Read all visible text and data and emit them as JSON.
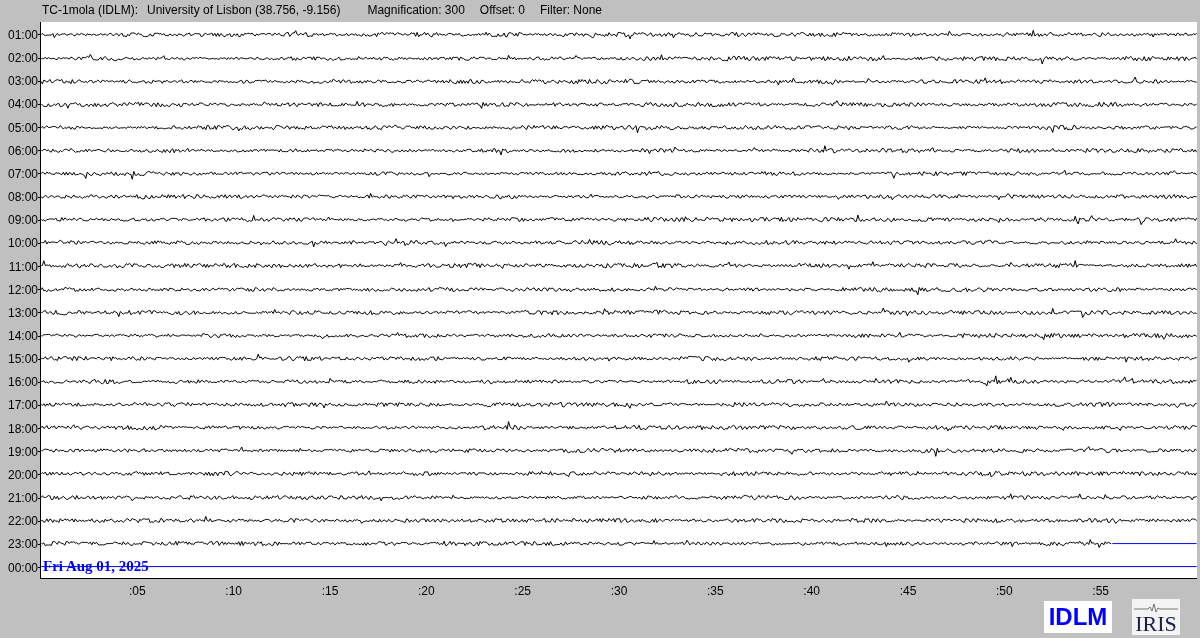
{
  "header": {
    "station": "TC-1mola (IDLM):",
    "location": "University of Lisbon (38.756, -9.156)",
    "magnification": "Magnification: 300",
    "offset": "Offset: 0",
    "filter": "Filter: None"
  },
  "rows": [
    {
      "time": "01:00",
      "kind": "trace"
    },
    {
      "time": "02:00",
      "kind": "trace"
    },
    {
      "time": "03:00",
      "kind": "trace"
    },
    {
      "time": "04:00",
      "kind": "trace"
    },
    {
      "time": "05:00",
      "kind": "trace"
    },
    {
      "time": "06:00",
      "kind": "trace"
    },
    {
      "time": "07:00",
      "kind": "trace"
    },
    {
      "time": "08:00",
      "kind": "trace"
    },
    {
      "time": "09:00",
      "kind": "trace"
    },
    {
      "time": "10:00",
      "kind": "trace"
    },
    {
      "time": "11:00",
      "kind": "trace"
    },
    {
      "time": "12:00",
      "kind": "trace"
    },
    {
      "time": "13:00",
      "kind": "trace"
    },
    {
      "time": "14:00",
      "kind": "trace"
    },
    {
      "time": "15:00",
      "kind": "trace"
    },
    {
      "time": "16:00",
      "kind": "trace"
    },
    {
      "time": "17:00",
      "kind": "trace"
    },
    {
      "time": "18:00",
      "kind": "trace"
    },
    {
      "time": "19:00",
      "kind": "trace"
    },
    {
      "time": "20:00",
      "kind": "trace"
    },
    {
      "time": "21:00",
      "kind": "trace"
    },
    {
      "time": "22:00",
      "kind": "trace"
    },
    {
      "time": "23:00",
      "kind": "partial",
      "level": 0.927
    },
    {
      "time": "00:00",
      "kind": "empty",
      "date": "Fri Aug 01, 2025"
    }
  ],
  "x_ticks": [
    ":05",
    ":10",
    ":15",
    ":20",
    ":25",
    ":30",
    ":35",
    ":40",
    ":45",
    ":50",
    ":55"
  ],
  "logos": {
    "station": "IDLM",
    "network": "IRIS"
  }
}
